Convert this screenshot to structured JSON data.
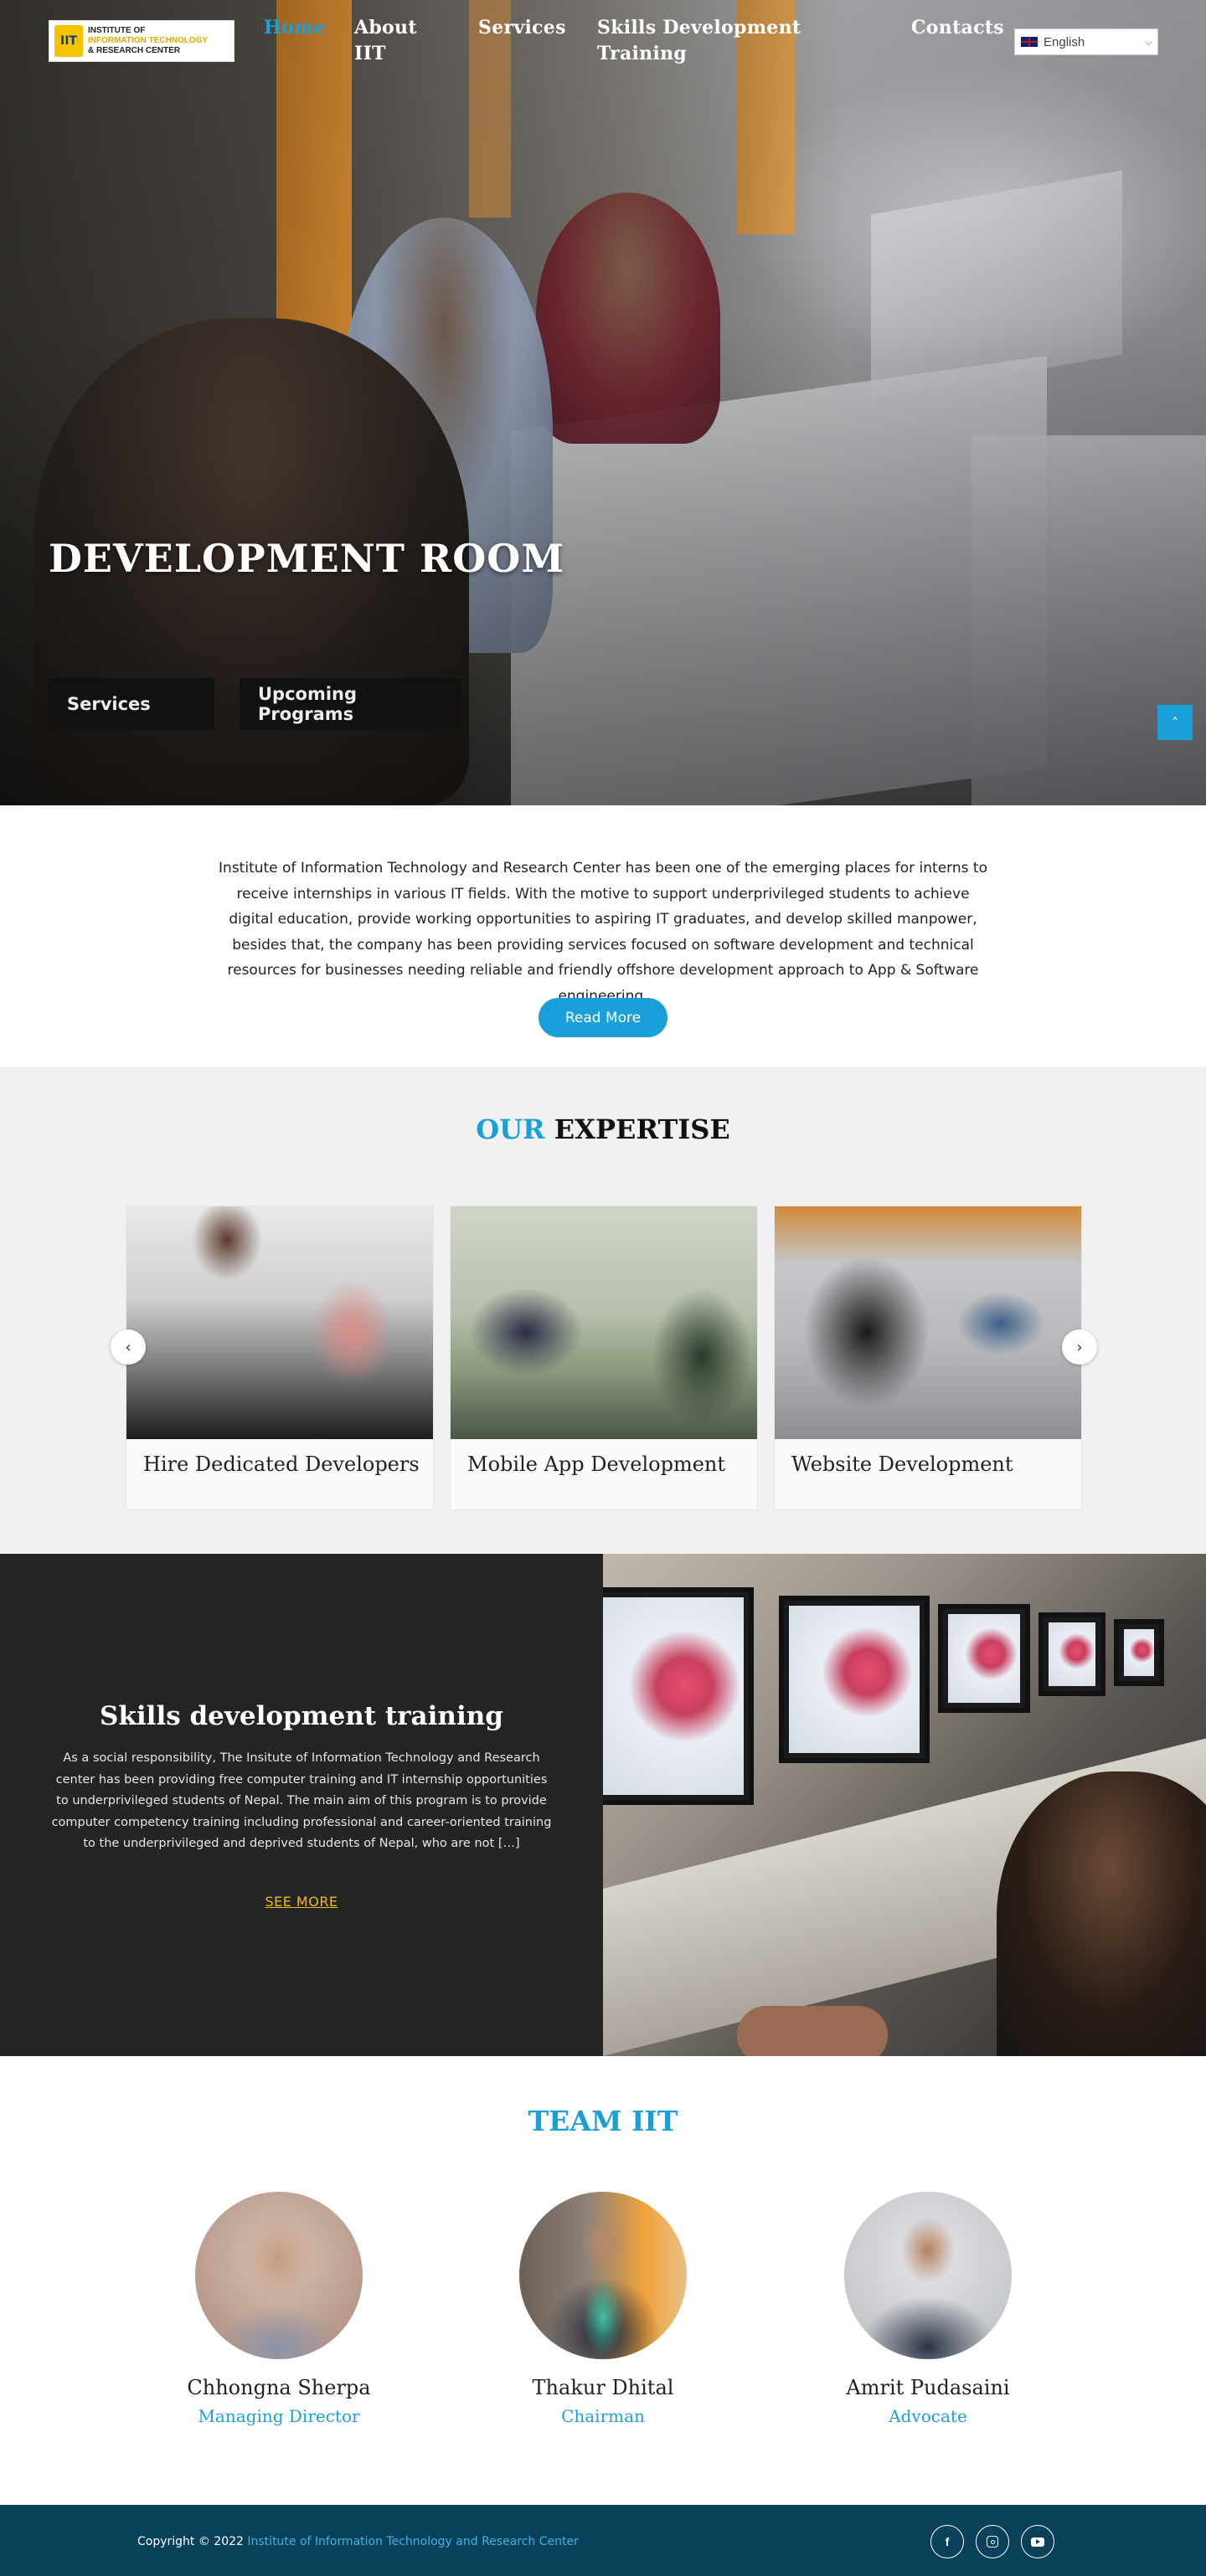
{
  "logo": {
    "line1": "INSTITUTE OF",
    "line2": "INFORMATION TECHNOLOGY",
    "line3": "& RESEARCH CENTER",
    "mark": "IIT"
  },
  "nav": {
    "home": "Home",
    "about_l1": "About",
    "about_l2": "IIT",
    "services": "Services",
    "skills_l1": "Skills Development",
    "skills_l2": "Training",
    "contacts": "Contacts"
  },
  "language": {
    "selected": "English",
    "icon": "uk-flag-icon"
  },
  "hero": {
    "title": "DEVELOPMENT ROOM",
    "buttons": [
      "Services",
      "Upcoming Programs"
    ]
  },
  "intro": {
    "text": "Institute of Information Technology and Research Center has been one of the emerging places for interns to receive internships in various IT fields. With the motive to support underprivileged students to achieve digital education, provide working opportunities to aspiring IT graduates, and develop skilled manpower, besides that, the company has been providing services focused on software development and technical resources for businesses needing reliable and friendly offshore development approach to App & Software engineering.",
    "read_more": "Read More"
  },
  "expertise": {
    "title_blue": "OUR",
    "title_dark": "EXPERTISE",
    "cards": [
      {
        "caption": "Hire Dedicated Developers"
      },
      {
        "caption": "Mobile App Development"
      },
      {
        "caption": "Website Development"
      }
    ]
  },
  "skills": {
    "title": "Skills development training",
    "text": "As a social responsibility, The Insitute of Information Technology and Research center has been providing free computer training and IT internship opportunities to underprivileged students of Nepal. The main aim of this program is to provide computer competency training including professional and career-oriented training to the underprivileged and deprived students of Nepal, who are not […]",
    "see_more": "SEE MORE"
  },
  "team": {
    "title": "TEAM IIT",
    "members": [
      {
        "name": "Chhongna Sherpa",
        "role": "Managing Director"
      },
      {
        "name": "Thakur Dhital",
        "role": "Chairman"
      },
      {
        "name": "Amrit Pudasaini",
        "role": "Advocate"
      }
    ]
  },
  "footer": {
    "copyright": "Copyright © 2022",
    "org_link": "Institute of Information Technology and Research Center",
    "social": [
      "facebook-icon",
      "instagram-icon",
      "youtube-icon"
    ]
  },
  "colors": {
    "accent": "#1a9fd9",
    "footer_bg": "#09405a",
    "skills_bg": "#232524",
    "see_more": "#f0b81a"
  }
}
